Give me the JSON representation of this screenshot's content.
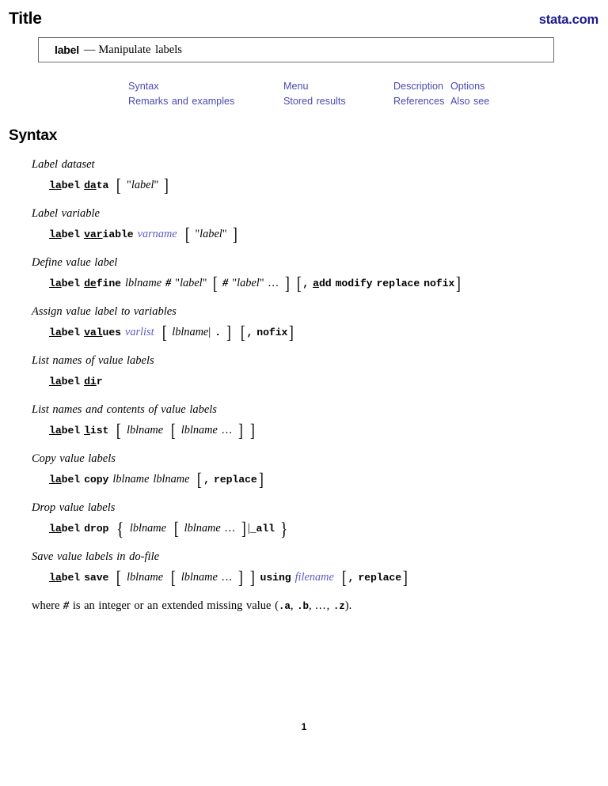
{
  "header": {
    "title": "Title",
    "site_link": "stata.com"
  },
  "title_box": {
    "command": "label",
    "dash": "—",
    "description": "Manipulate labels"
  },
  "nav": {
    "links": [
      "Syntax",
      "Menu",
      "Description",
      "Options",
      "Remarks and examples",
      "Stored results",
      "References",
      "Also see"
    ]
  },
  "syntax": {
    "heading": "Syntax",
    "blocks": [
      {
        "heading": "Label dataset",
        "command": "label data [ \"label\" ]",
        "parts": {
          "cmd_underlined": "la",
          "cmd_rest": "bel",
          "sub_underlined": "da",
          "sub_rest": "ta",
          "opt_label": "\"label\""
        }
      },
      {
        "heading": "Label variable",
        "command": "label variable varname [ \"label\" ]",
        "parts": {
          "cmd_underlined": "la",
          "cmd_rest": "bel",
          "sub_underlined": "var",
          "sub_rest": "iable",
          "arg": "varname",
          "opt_label": "\"label\""
        }
      },
      {
        "heading": "Define value label",
        "command": "label define lblname # \"label\" [ # \"label\" ... ] [ , add modify replace nofix ]",
        "parts": {
          "cmd_underlined": "la",
          "cmd_rest": "bel",
          "sub_underlined": "de",
          "sub_rest": "fine",
          "arg": "lblname",
          "hash": "#",
          "label_lit": "\"label\"",
          "dots": "...",
          "comma": ",",
          "opt_add_u": "a",
          "opt_add_rest": "dd",
          "opt_modify": "modify",
          "opt_replace": "replace",
          "opt_nofix": "nofix"
        }
      },
      {
        "heading": "Assign value label to variables",
        "command": "label values varlist [ lblname | . ] [ , nofix ]",
        "parts": {
          "cmd_underlined": "la",
          "cmd_rest": "bel",
          "sub_underlined": "val",
          "sub_rest": "ues",
          "arg": "varlist",
          "arg2": "lblname",
          "dot": ".",
          "comma": ",",
          "opt_nofix": "nofix"
        }
      },
      {
        "heading": "List names of value labels",
        "command": "label dir",
        "parts": {
          "cmd_underlined": "la",
          "cmd_rest": "bel",
          "sub_underlined": "di",
          "sub_rest": "r"
        }
      },
      {
        "heading": "List names and contents of value labels",
        "command": "label list [ lblname [ lblname ... ] ]",
        "parts": {
          "cmd_underlined": "la",
          "cmd_rest": "bel",
          "sub_underlined": "l",
          "sub_rest": "ist",
          "arg": "lblname",
          "arg2": "lblname",
          "dots": "..."
        }
      },
      {
        "heading": "Copy value labels",
        "command": "label copy lblname lblname [ , replace ]",
        "parts": {
          "cmd_underlined": "la",
          "cmd_rest": "bel",
          "sub_underlined": "",
          "sub_rest": "copy",
          "arg": "lblname",
          "arg2": "lblname",
          "comma": ",",
          "opt_replace": "replace"
        }
      },
      {
        "heading": "Drop value labels",
        "command": "label drop { lblname [ lblname ... ] | _all }",
        "parts": {
          "cmd_underlined": "la",
          "cmd_rest": "bel",
          "sub_underlined": "",
          "sub_rest": "drop",
          "arg": "lblname",
          "arg2": "lblname",
          "dots": "...",
          "all_lit": "_all"
        }
      },
      {
        "heading": "Save value labels in do-file",
        "command": "label save [ lblname [ lblname ... ] ] using filename [ , replace ]",
        "parts": {
          "cmd_underlined": "la",
          "cmd_rest": "bel",
          "sub_underlined": "",
          "sub_rest": "save",
          "arg": "lblname",
          "arg2": "lblname",
          "dots": "...",
          "using": "using",
          "filename": "filename",
          "comma": ",",
          "opt_replace": "replace"
        }
      }
    ],
    "where_note": {
      "pre": "where ",
      "hash": "#",
      "mid": " is an integer or an extended missing value (",
      "a": ".a",
      "sep1": ", ",
      "b": ".b",
      "sep2": ", ",
      "dots": "...",
      "sep3": ", ",
      "z": ".z",
      "post": ")."
    }
  },
  "footer": {
    "page_number": "1"
  },
  "colors": {
    "link": "#4a4ab0",
    "brand": "#1a1a8c",
    "arg_blue": "#5b5bc4",
    "box_border": "#6f6f6f"
  }
}
